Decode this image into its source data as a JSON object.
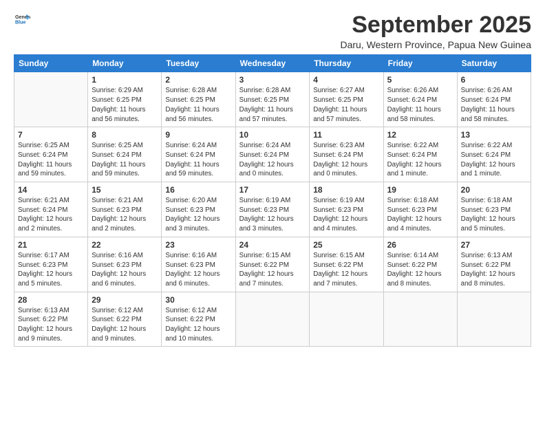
{
  "logo": {
    "line1": "General",
    "line2": "Blue"
  },
  "title": "September 2025",
  "subtitle": "Daru, Western Province, Papua New Guinea",
  "days_of_week": [
    "Sunday",
    "Monday",
    "Tuesday",
    "Wednesday",
    "Thursday",
    "Friday",
    "Saturday"
  ],
  "weeks": [
    [
      {
        "day": "",
        "info": ""
      },
      {
        "day": "1",
        "info": "Sunrise: 6:29 AM\nSunset: 6:25 PM\nDaylight: 11 hours\nand 56 minutes."
      },
      {
        "day": "2",
        "info": "Sunrise: 6:28 AM\nSunset: 6:25 PM\nDaylight: 11 hours\nand 56 minutes."
      },
      {
        "day": "3",
        "info": "Sunrise: 6:28 AM\nSunset: 6:25 PM\nDaylight: 11 hours\nand 57 minutes."
      },
      {
        "day": "4",
        "info": "Sunrise: 6:27 AM\nSunset: 6:25 PM\nDaylight: 11 hours\nand 57 minutes."
      },
      {
        "day": "5",
        "info": "Sunrise: 6:26 AM\nSunset: 6:24 PM\nDaylight: 11 hours\nand 58 minutes."
      },
      {
        "day": "6",
        "info": "Sunrise: 6:26 AM\nSunset: 6:24 PM\nDaylight: 11 hours\nand 58 minutes."
      }
    ],
    [
      {
        "day": "7",
        "info": "Sunrise: 6:25 AM\nSunset: 6:24 PM\nDaylight: 11 hours\nand 59 minutes."
      },
      {
        "day": "8",
        "info": "Sunrise: 6:25 AM\nSunset: 6:24 PM\nDaylight: 11 hours\nand 59 minutes."
      },
      {
        "day": "9",
        "info": "Sunrise: 6:24 AM\nSunset: 6:24 PM\nDaylight: 11 hours\nand 59 minutes."
      },
      {
        "day": "10",
        "info": "Sunrise: 6:24 AM\nSunset: 6:24 PM\nDaylight: 12 hours\nand 0 minutes."
      },
      {
        "day": "11",
        "info": "Sunrise: 6:23 AM\nSunset: 6:24 PM\nDaylight: 12 hours\nand 0 minutes."
      },
      {
        "day": "12",
        "info": "Sunrise: 6:22 AM\nSunset: 6:24 PM\nDaylight: 12 hours\nand 1 minute."
      },
      {
        "day": "13",
        "info": "Sunrise: 6:22 AM\nSunset: 6:24 PM\nDaylight: 12 hours\nand 1 minute."
      }
    ],
    [
      {
        "day": "14",
        "info": "Sunrise: 6:21 AM\nSunset: 6:24 PM\nDaylight: 12 hours\nand 2 minutes."
      },
      {
        "day": "15",
        "info": "Sunrise: 6:21 AM\nSunset: 6:23 PM\nDaylight: 12 hours\nand 2 minutes."
      },
      {
        "day": "16",
        "info": "Sunrise: 6:20 AM\nSunset: 6:23 PM\nDaylight: 12 hours\nand 3 minutes."
      },
      {
        "day": "17",
        "info": "Sunrise: 6:19 AM\nSunset: 6:23 PM\nDaylight: 12 hours\nand 3 minutes."
      },
      {
        "day": "18",
        "info": "Sunrise: 6:19 AM\nSunset: 6:23 PM\nDaylight: 12 hours\nand 4 minutes."
      },
      {
        "day": "19",
        "info": "Sunrise: 6:18 AM\nSunset: 6:23 PM\nDaylight: 12 hours\nand 4 minutes."
      },
      {
        "day": "20",
        "info": "Sunrise: 6:18 AM\nSunset: 6:23 PM\nDaylight: 12 hours\nand 5 minutes."
      }
    ],
    [
      {
        "day": "21",
        "info": "Sunrise: 6:17 AM\nSunset: 6:23 PM\nDaylight: 12 hours\nand 5 minutes."
      },
      {
        "day": "22",
        "info": "Sunrise: 6:16 AM\nSunset: 6:23 PM\nDaylight: 12 hours\nand 6 minutes."
      },
      {
        "day": "23",
        "info": "Sunrise: 6:16 AM\nSunset: 6:23 PM\nDaylight: 12 hours\nand 6 minutes."
      },
      {
        "day": "24",
        "info": "Sunrise: 6:15 AM\nSunset: 6:22 PM\nDaylight: 12 hours\nand 7 minutes."
      },
      {
        "day": "25",
        "info": "Sunrise: 6:15 AM\nSunset: 6:22 PM\nDaylight: 12 hours\nand 7 minutes."
      },
      {
        "day": "26",
        "info": "Sunrise: 6:14 AM\nSunset: 6:22 PM\nDaylight: 12 hours\nand 8 minutes."
      },
      {
        "day": "27",
        "info": "Sunrise: 6:13 AM\nSunset: 6:22 PM\nDaylight: 12 hours\nand 8 minutes."
      }
    ],
    [
      {
        "day": "28",
        "info": "Sunrise: 6:13 AM\nSunset: 6:22 PM\nDaylight: 12 hours\nand 9 minutes."
      },
      {
        "day": "29",
        "info": "Sunrise: 6:12 AM\nSunset: 6:22 PM\nDaylight: 12 hours\nand 9 minutes."
      },
      {
        "day": "30",
        "info": "Sunrise: 6:12 AM\nSunset: 6:22 PM\nDaylight: 12 hours\nand 10 minutes."
      },
      {
        "day": "",
        "info": ""
      },
      {
        "day": "",
        "info": ""
      },
      {
        "day": "",
        "info": ""
      },
      {
        "day": "",
        "info": ""
      }
    ]
  ]
}
